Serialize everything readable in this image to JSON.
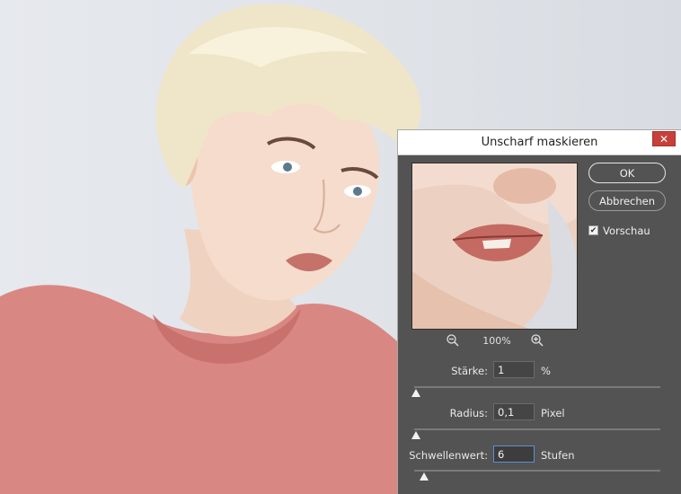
{
  "dialog": {
    "title": "Unscharf maskieren",
    "close_glyph": "✕",
    "zoom_out_icon": "zoom-out-icon",
    "zoom_in_icon": "zoom-in-icon",
    "zoom_level": "100%",
    "ok_label": "OK",
    "cancel_label": "Abbrechen",
    "preview_label": "Vorschau",
    "preview_checked": true,
    "amount": {
      "label": "Stärke:",
      "value": "1",
      "unit": "%"
    },
    "radius": {
      "label": "Radius:",
      "value": "0,1",
      "unit": "Pixel"
    },
    "threshold": {
      "label": "Schwellenwert:",
      "value": "6",
      "unit": "Stufen"
    }
  },
  "colors": {
    "dialog_bg": "#535353",
    "close_button": "#c7403a",
    "focus_border": "#5b8fd6"
  }
}
